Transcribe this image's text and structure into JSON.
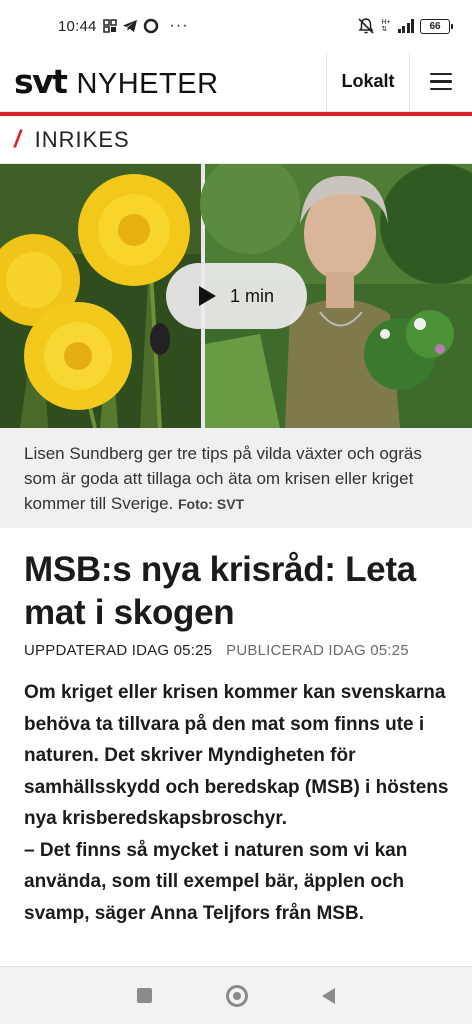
{
  "status_bar": {
    "time": "10:44",
    "battery": "66",
    "network_label": "H+"
  },
  "header": {
    "logo_brand": "svt",
    "logo_section": "NYHETER",
    "lokalt_label": "Lokalt"
  },
  "section": {
    "title": "INRIKES"
  },
  "media": {
    "duration_label": "1 min"
  },
  "caption": {
    "text": "Lisen Sundberg ger tre tips på vilda växter och ogräs som är goda att tillaga och äta om krisen eller kriget kommer till Sverige.",
    "credit": "Foto: SVT"
  },
  "article": {
    "headline": "MSB:s nya krisråd: Leta mat i skogen",
    "updated": "UPPDATERAD IDAG 05:25",
    "published": "PUBLICERAD IDAG 05:25",
    "lead": "Om kriget eller krisen kommer kan svenskarna behöva ta tillvara på den mat som finns ute i naturen. Det skriver Myndigheten för samhällsskydd och beredskap (MSB) i höstens nya krisberedskapsbroschyr.",
    "quote": "– Det finns så mycket i naturen som vi kan använda, som till exempel bär, äpplen och svamp, säger Anna Teljfors från MSB."
  },
  "colors": {
    "accent_red": "#d9232a",
    "caption_bg": "#f0f0f0"
  },
  "icons": {
    "menu": "hamburger-icon",
    "play": "play-icon",
    "nav": [
      "square-nav-icon",
      "home-circle-icon",
      "back-triangle-icon"
    ]
  }
}
